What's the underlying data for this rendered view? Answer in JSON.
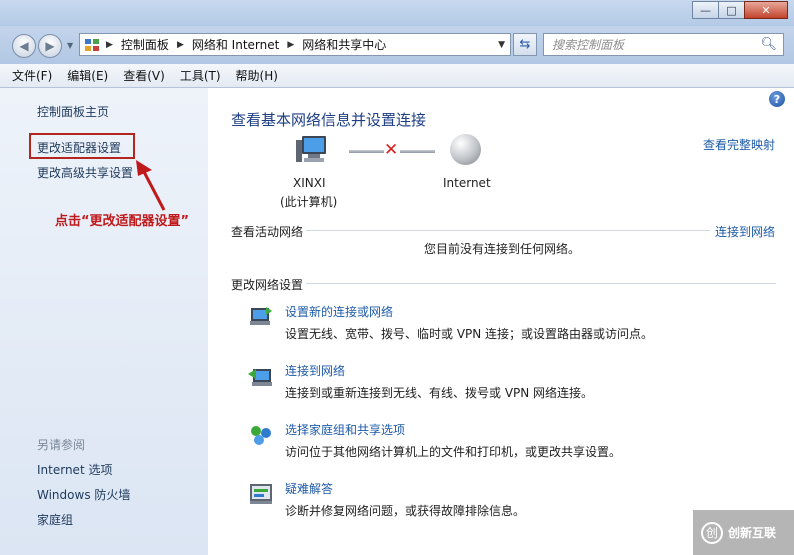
{
  "window": {
    "minimize_glyph": "—",
    "maximize_glyph": "□",
    "close_glyph": "✕"
  },
  "address_bar": {
    "back_glyph": "◀",
    "forward_glyph": "▶",
    "breadcrumbs": [
      "控制面板",
      "网络和 Internet",
      "网络和共享中心"
    ],
    "search_placeholder": "搜索控制面板"
  },
  "menu": [
    "文件(F)",
    "编辑(E)",
    "查看(V)",
    "工具(T)",
    "帮助(H)"
  ],
  "sidebar": {
    "home": "控制面板主页",
    "change_adapter": "更改适配器设置",
    "change_sharing": "更改高级共享设置",
    "see_also": "另请参阅",
    "links": [
      "Internet 选项",
      "Windows 防火墙",
      "家庭组"
    ]
  },
  "annotation": {
    "text": "点击“更改适配器设置”",
    "color": "#c0191b"
  },
  "main": {
    "title": "查看基本网络信息并设置连接",
    "full_map": "查看完整映射",
    "computer_name": "XINXI",
    "computer_sub": "(此计算机)",
    "internet_label": "Internet",
    "active_networks": "查看活动网络",
    "connect_link": "连接到网络",
    "no_network": "您目前没有连接到任何网络。",
    "change_settings": "更改网络设置",
    "tasks": [
      {
        "icon": "new-connection-icon",
        "title": "设置新的连接或网络",
        "desc": "设置无线、宽带、拨号、临时或 VPN 连接；或设置路由器或访问点。"
      },
      {
        "icon": "connect-network-icon",
        "title": "连接到网络",
        "desc": "连接到或重新连接到无线、有线、拨号或 VPN 网络连接。"
      },
      {
        "icon": "homegroup-icon",
        "title": "选择家庭组和共享选项",
        "desc": "访问位于其他网络计算机上的文件和打印机，或更改共享设置。"
      },
      {
        "icon": "troubleshoot-icon",
        "title": "疑难解答",
        "desc": "诊断并修复网络问题，或获得故障排除信息。"
      }
    ]
  },
  "watermark": {
    "logo_glyph": "创",
    "text": "创新互联"
  },
  "colors": {
    "link": "#1e5ba8",
    "title": "#1e3e86",
    "highlight_box": "#b5261e"
  }
}
